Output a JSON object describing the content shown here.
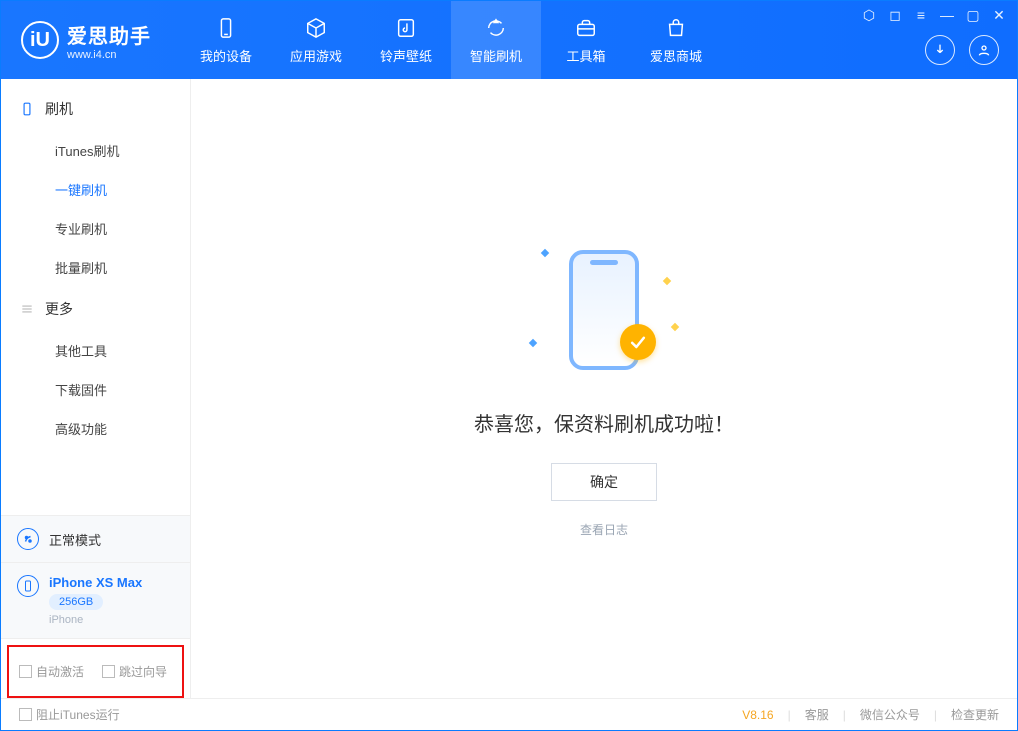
{
  "app": {
    "name": "爱思助手",
    "url": "www.i4.cn",
    "logo_letter": "iU"
  },
  "nav": {
    "items": [
      {
        "label": "我的设备",
        "icon": "phone-icon"
      },
      {
        "label": "应用游戏",
        "icon": "cube-icon"
      },
      {
        "label": "铃声壁纸",
        "icon": "music-icon"
      },
      {
        "label": "智能刷机",
        "icon": "refresh-icon",
        "active": true
      },
      {
        "label": "工具箱",
        "icon": "toolbox-icon"
      },
      {
        "label": "爱思商城",
        "icon": "bag-icon"
      }
    ]
  },
  "sidebar": {
    "groups": [
      {
        "title": "刷机",
        "icon": "phone-outline-icon",
        "items": [
          {
            "label": "iTunes刷机"
          },
          {
            "label": "一键刷机",
            "active": true
          },
          {
            "label": "专业刷机"
          },
          {
            "label": "批量刷机"
          }
        ]
      },
      {
        "title": "更多",
        "icon": "menu-lines-icon",
        "items": [
          {
            "label": "其他工具"
          },
          {
            "label": "下载固件"
          },
          {
            "label": "高级功能"
          }
        ]
      }
    ],
    "mode": {
      "label": "正常模式"
    },
    "device": {
      "name": "iPhone XS Max",
      "storage": "256GB",
      "subtype": "iPhone"
    },
    "options": {
      "auto_activate": "自动激活",
      "skip_wizard": "跳过向导"
    }
  },
  "main": {
    "success_text": "恭喜您，保资料刷机成功啦！",
    "confirm": "确定",
    "view_log": "查看日志"
  },
  "footer": {
    "block_itunes": "阻止iTunes运行",
    "version": "V8.16",
    "links": [
      "客服",
      "微信公众号",
      "检查更新"
    ]
  }
}
